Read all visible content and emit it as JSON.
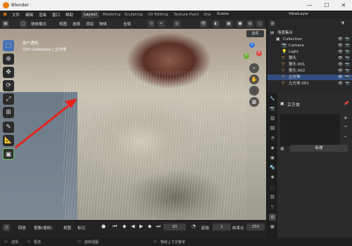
{
  "app": {
    "title": "Blender"
  },
  "window_controls": {
    "min": "—",
    "max": "☐",
    "close": "✕"
  },
  "menubar": {
    "items": [
      "文件",
      "编辑",
      "渲染",
      "窗口",
      "帮助"
    ],
    "workspaces": [
      "Layout",
      "Modeling",
      "Sculpting",
      "UV Editing",
      "Texture Paint",
      "Sha"
    ],
    "active_workspace": "Layout",
    "scene": "Scene",
    "view_layer": "ViewLayer"
  },
  "viewport_header": {
    "mode": "物体模式",
    "menus": [
      "视图",
      "选择",
      "添加",
      "物体"
    ],
    "orientation": "全局",
    "toggle": "选项"
  },
  "viewport": {
    "view_name": "用户透视",
    "collection_info": "(20) Collection | 立方体",
    "gizmo_axes": {
      "x": "X",
      "y": "Y",
      "z": "Z"
    }
  },
  "tools": [
    "select-box",
    "cursor",
    "move",
    "rotate",
    "scale",
    "transform",
    "annotate",
    "measure",
    "add-cube"
  ],
  "timeline": {
    "menus": [
      "回放",
      "抠像(插帧)",
      "视图",
      "标记"
    ],
    "current_frame": "20",
    "start_label": "起始",
    "start": "1",
    "end_label": "结束点",
    "end": "250"
  },
  "statusbar": {
    "items": [
      "选择",
      "框选",
      "旋转视图",
      "物体上下文菜单"
    ]
  },
  "outliner": {
    "root": "场景集合",
    "rows": [
      {
        "name": "Collection",
        "indent": 1,
        "icon": "▣",
        "selected": false
      },
      {
        "name": "Camera",
        "indent": 2,
        "icon": "📷",
        "selected": false
      },
      {
        "name": "Light",
        "indent": 2,
        "icon": "💡",
        "selected": false
      },
      {
        "name": "猴头",
        "indent": 2,
        "icon": "▽",
        "selected": false
      },
      {
        "name": "猴头.001",
        "indent": 2,
        "icon": "▽",
        "selected": false
      },
      {
        "name": "猴头.002",
        "indent": 2,
        "icon": "▽",
        "selected": false
      },
      {
        "name": "立方体",
        "indent": 2,
        "icon": "▽",
        "selected": true
      },
      {
        "name": "立方体.001",
        "indent": 2,
        "icon": "▽",
        "selected": false
      }
    ]
  },
  "properties": {
    "object_name": "立方体",
    "new_button": "新建"
  },
  "colors": {
    "accent": "#4772b3",
    "arrow": "#e8231f"
  }
}
